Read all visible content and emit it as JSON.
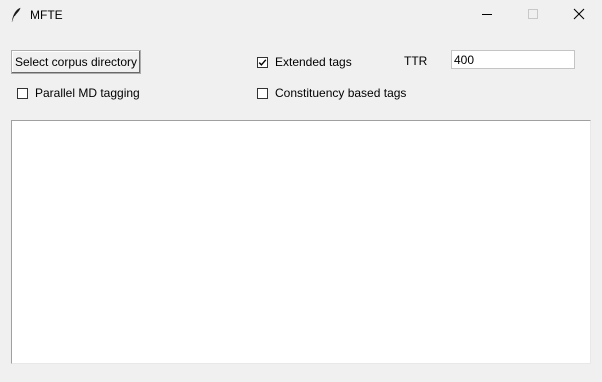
{
  "window": {
    "title": "MFTE",
    "icon": "feather-icon",
    "controls": [
      "minimize-icon",
      "maximize-icon",
      "close-icon"
    ]
  },
  "controls": {
    "select_button_label": "Select corpus directory",
    "extended_tags": {
      "label": "Extended tags",
      "checked": true
    },
    "parallel_md": {
      "label": "Parallel MD tagging",
      "checked": false
    },
    "constituency": {
      "label": "Constituency based tags",
      "checked": false
    },
    "ttr": {
      "label": "TTR",
      "value": "400"
    }
  },
  "output_text": ""
}
